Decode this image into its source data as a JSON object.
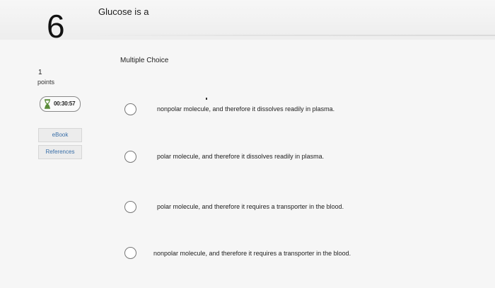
{
  "question": {
    "number": "6",
    "prompt": "Glucose is a",
    "type_label": "Multiple Choice",
    "options": [
      {
        "label": "nonpolar molecule, and therefore it dissolves readily in plasma."
      },
      {
        "label": "polar molecule, and therefore it dissolves readily in plasma."
      },
      {
        "label": "polar molecule, and therefore it requires a transporter in the blood."
      },
      {
        "label": "nonpolar molecule, and therefore it requires a transporter in the blood."
      }
    ]
  },
  "sidebar": {
    "points_value": "1",
    "points_label": "points",
    "timer": "00:30:57",
    "timer_icon": "hourglass-icon",
    "ebook_label": "eBook",
    "references_label": "References"
  },
  "colors": {
    "link": "#3a6fa8",
    "radio_border": "#777777",
    "background": "#f6f6f6"
  }
}
